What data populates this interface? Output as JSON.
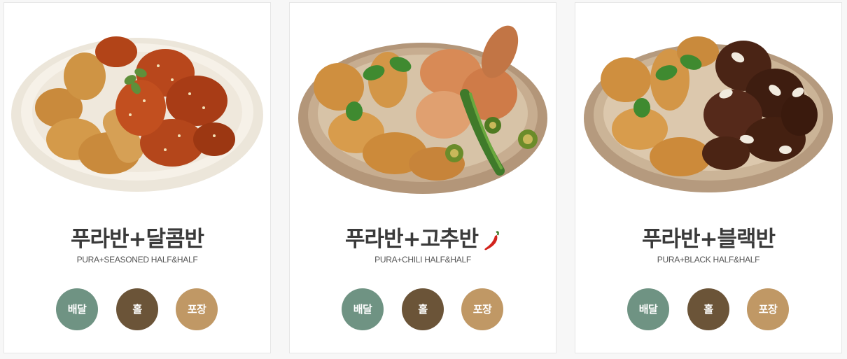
{
  "colors": {
    "delivery": "#6f9383",
    "hall": "#6b5438",
    "takeout": "#c09865"
  },
  "menu": [
    {
      "name": "푸라반+달콤반",
      "subtitle": "PURA+SEASONED HALF&HALF",
      "spicy": false,
      "buttons": {
        "delivery": "배달",
        "hall": "홀",
        "takeout": "포장"
      }
    },
    {
      "name": "푸라반+고추반",
      "subtitle": "PURA+CHILI HALF&HALF",
      "spicy": true,
      "buttons": {
        "delivery": "배달",
        "hall": "홀",
        "takeout": "포장"
      }
    },
    {
      "name": "푸라반+블랙반",
      "subtitle": "PURA+BLACK HALF&HALF",
      "spicy": false,
      "buttons": {
        "delivery": "배달",
        "hall": "홀",
        "takeout": "포장"
      }
    }
  ]
}
